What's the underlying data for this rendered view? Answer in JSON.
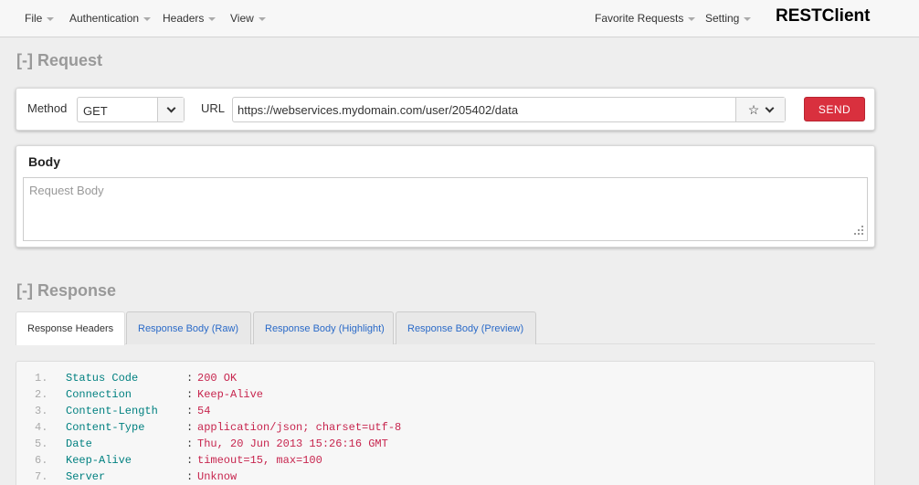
{
  "navbar": {
    "items": [
      {
        "label": "File"
      },
      {
        "label": "Authentication"
      },
      {
        "label": "Headers"
      },
      {
        "label": "View"
      }
    ],
    "right_items": [
      {
        "label": "Favorite Requests"
      },
      {
        "label": "Setting"
      }
    ],
    "brand": "RESTClient"
  },
  "request": {
    "title": "[-] Request",
    "method_label": "Method",
    "method_value": "GET",
    "url_label": "URL",
    "url_value": "https://webservices.mydomain.com/user/205402/data",
    "send_label": "SEND",
    "body_title": "Body",
    "body_placeholder": "Request Body"
  },
  "response": {
    "title": "[-] Response",
    "tabs": [
      {
        "label": "Response Headers"
      },
      {
        "label": "Response Body (Raw)"
      },
      {
        "label": "Response Body (Highlight)"
      },
      {
        "label": "Response Body (Preview)"
      }
    ],
    "active_tab": "Response Headers",
    "headers": [
      {
        "num": "1.",
        "key": "Status Code",
        "value": "200 OK"
      },
      {
        "num": "2.",
        "key": "Connection",
        "value": "Keep-Alive"
      },
      {
        "num": "3.",
        "key": "Content-Length",
        "value": "54"
      },
      {
        "num": "4.",
        "key": "Content-Type",
        "value": "application/json; charset=utf-8"
      },
      {
        "num": "5.",
        "key": "Date",
        "value": "Thu, 20 Jun 2013 15:26:16 GMT"
      },
      {
        "num": "6.",
        "key": "Keep-Alive",
        "value": "timeout=15, max=100"
      },
      {
        "num": "7.",
        "key": "Server",
        "value": "Unknow"
      }
    ]
  },
  "icons": {
    "dropdown": "chevron-down-icon",
    "favorite": "star-icon",
    "resize": "resize-grip-icon"
  },
  "colors": {
    "send_button": "#d9303e",
    "tab_link": "#2a6ac8",
    "header_key": "#008080",
    "header_value": "#c7254e",
    "section_title": "#999999"
  }
}
